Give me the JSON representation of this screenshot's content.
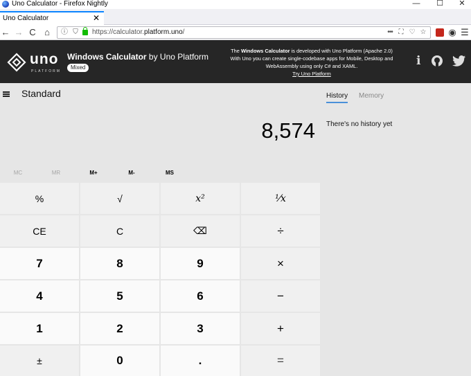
{
  "window": {
    "title": "Uno Calculator - Firefox Nightly",
    "controls": {
      "minimize": "—",
      "maximize": "☐",
      "close": "✕"
    }
  },
  "tab": {
    "label": "Uno Calculator",
    "close": "✕"
  },
  "nav": {
    "back": "←",
    "forward": "→",
    "reload": "C",
    "home": "⌂",
    "url_prefix": "https://calculator.",
    "url_domain": "platform.uno",
    "url_suffix": "/",
    "overflow": "•••"
  },
  "header": {
    "logo_word": "uno",
    "logo_sub": "PLATFORM",
    "app_title_bold": "Windows Calculator",
    "app_title_rest": " by Uno Platform",
    "badge": "Mixed",
    "info_line1_pre": "The ",
    "info_line1_bold": "Windows Calculator",
    "info_line1_post": " is developed with Uno Platform (Apache 2.0)",
    "info_line2": "With Uno you can create single-codebase apps for Mobile, Desktop and",
    "info_line3": "WebAssembly using only C# and XAML.",
    "info_link": "Try Uno Platform",
    "icons": [
      "info-icon",
      "github-icon",
      "twitter-icon"
    ]
  },
  "calculator": {
    "mode": "Standard",
    "display": "8,574",
    "memory": [
      {
        "label": "MC",
        "enabled": false
      },
      {
        "label": "MR",
        "enabled": false
      },
      {
        "label": "M+",
        "enabled": true
      },
      {
        "label": "M-",
        "enabled": true
      },
      {
        "label": "MS",
        "enabled": true
      }
    ],
    "keys": {
      "percent": "%",
      "sqrt": "√",
      "square": "x²",
      "reciprocal": "¹⁄x",
      "ce": "CE",
      "clear": "C",
      "backspace": "⌫",
      "divide": "÷",
      "seven": "7",
      "eight": "8",
      "nine": "9",
      "multiply": "×",
      "four": "4",
      "five": "5",
      "six": "6",
      "minus": "−",
      "one": "1",
      "two": "2",
      "three": "3",
      "plus": "+",
      "negate": "±",
      "zero": "0",
      "decimal": ".",
      "equals": "="
    }
  },
  "history": {
    "tab_history": "History",
    "tab_memory": "Memory",
    "empty_message": "There's no history yet"
  },
  "colors": {
    "accent": "#4a90d9",
    "header_bg": "#262626",
    "calc_bg": "#e6e6e6",
    "op_key_bg": "#f0f0f0",
    "num_key_bg": "#fafafa"
  }
}
